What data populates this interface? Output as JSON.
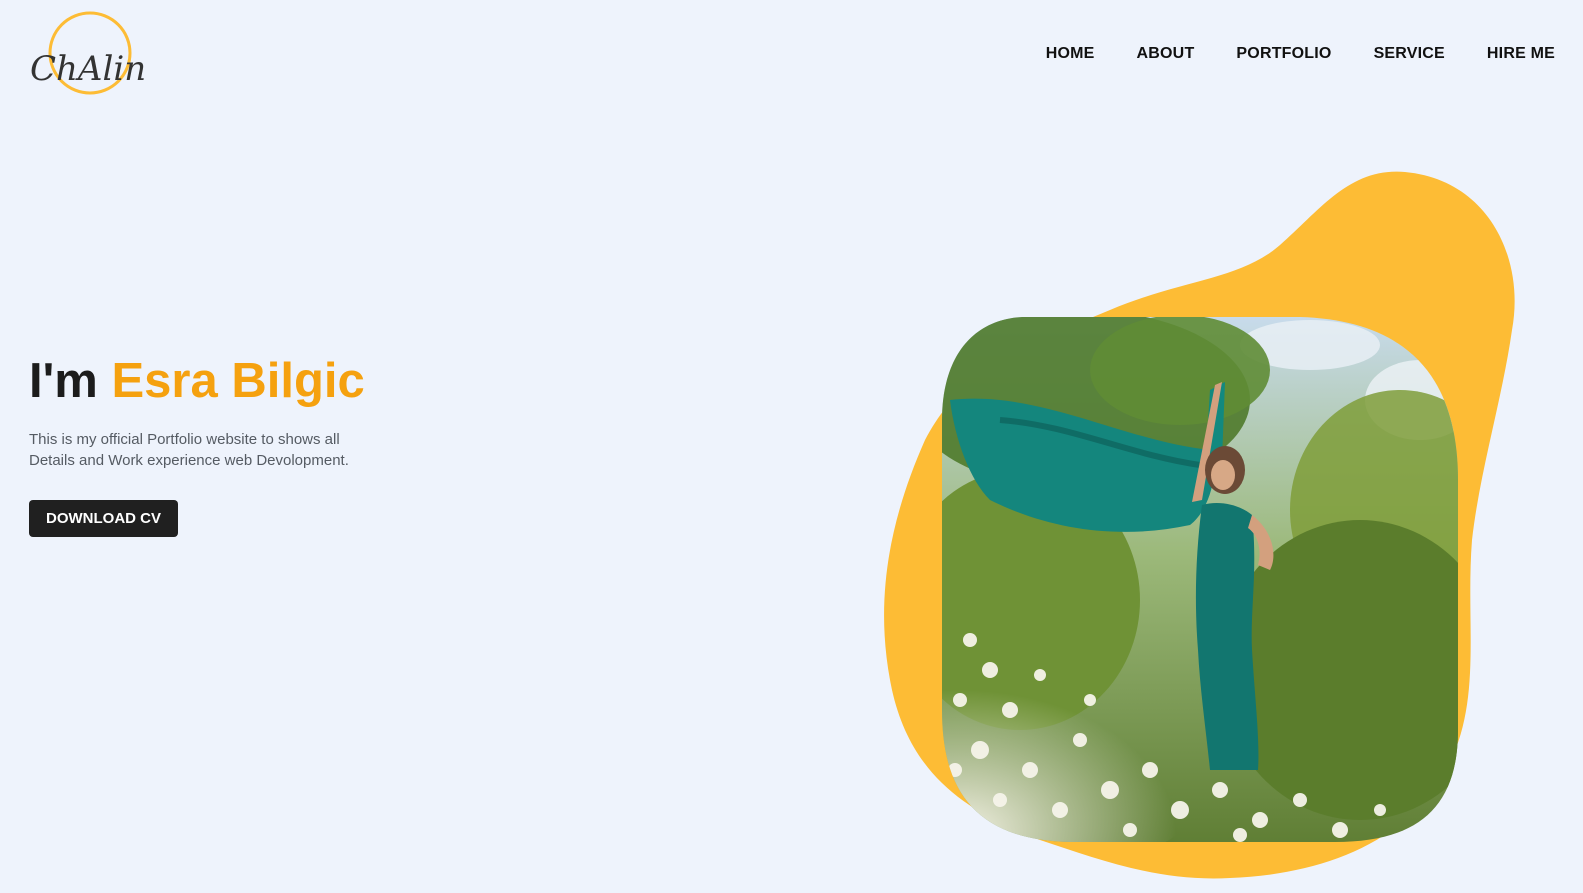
{
  "brand": {
    "logo_text": "ChAlin"
  },
  "nav": {
    "items": [
      {
        "label": "HOME"
      },
      {
        "label": "ABOUT"
      },
      {
        "label": "PORTFOLIO"
      },
      {
        "label": "SERVICE"
      },
      {
        "label": "HIRE ME"
      }
    ]
  },
  "hero": {
    "greeting": "I'm",
    "name": "Esra Bilgic",
    "description": "This is my official Portfolio website to shows all Details and Work experience web Devolopment.",
    "button_label": "DOWNLOAD CV"
  },
  "colors": {
    "accent": "#f5a10f",
    "blob": "#fdbc35",
    "background": "#eef3fc",
    "button_bg": "#202020"
  },
  "icons": {
    "logo": "chalin-logo-icon"
  },
  "image": {
    "description": "woman in teal gown holding a flowing teal scarf in a field of white flowers"
  }
}
